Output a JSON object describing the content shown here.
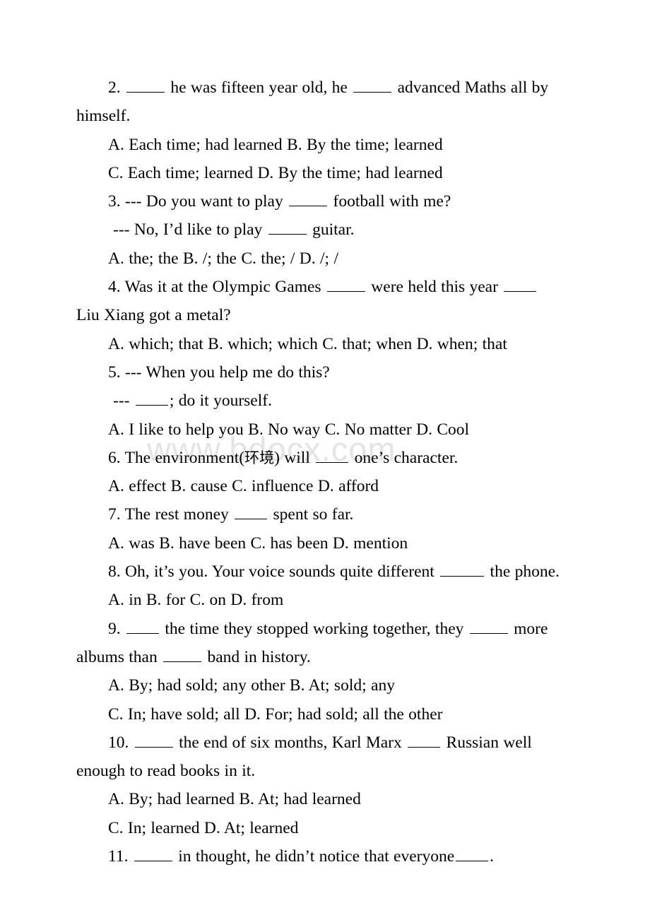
{
  "document": {
    "type": "exam-worksheet",
    "language": "English grammar multiple choice",
    "watermark": "www.bdocx.com",
    "watermark_color": "#e4e4e4",
    "text_color": "#000000",
    "background_color": "#ffffff"
  },
  "questions": [
    {
      "number": "2.",
      "stem_parts": [
        "2. ",
        " he was fifteen year old, he ",
        " advanced Maths all by himself."
      ],
      "stem_blanks": [
        "b-md",
        "b-md"
      ],
      "options": [
        "A. Each time; had learned B. By the time; learned",
        "C. Each time; learned D. By the time; had learned"
      ]
    },
    {
      "number": "3.",
      "stem_parts": [
        "3. --- Do you want to play ",
        " football with me?"
      ],
      "stem_blanks": [
        "b-md"
      ],
      "dialogue": [
        "--- No, I’d like to play ",
        " guitar."
      ],
      "dialogue_blanks": [
        "b-md"
      ],
      "options": [
        "A. the; the B. /; the C. the; / D. /; /"
      ]
    },
    {
      "number": "4.",
      "stem_parts": [
        "4. Was it at the Olympic Games ",
        " were held this year ",
        " Liu Xiang got a metal?"
      ],
      "stem_blanks": [
        "b-md",
        "b-sm"
      ],
      "options": [
        "A. which; that B. which; which C. that; when D. when; that"
      ]
    },
    {
      "number": "5.",
      "stem_parts": [
        "5. --- When you help me do this?"
      ],
      "stem_blanks": [],
      "dialogue": [
        "--- ",
        "; do it yourself."
      ],
      "dialogue_blanks": [
        "b-sm"
      ],
      "options": [
        "A. I like to help you B. No way C. No matter D. Cool"
      ]
    },
    {
      "number": "6.",
      "stem_parts": [
        "6. The environment(",
        "环境",
        ") will ",
        " one’s character."
      ],
      "stem_blanks": [
        "b-sm"
      ],
      "options": [
        "A. effect B. cause C. influence D. afford"
      ]
    },
    {
      "number": "7.",
      "stem_parts": [
        "7. The rest money ",
        " spent so far."
      ],
      "stem_blanks": [
        "b-sm"
      ],
      "options": [
        "A. was B. have been C. has been D. mention"
      ]
    },
    {
      "number": "8.",
      "stem_parts": [
        "8. Oh, it’s you. Your voice sounds quite different ",
        " the phone."
      ],
      "stem_blanks": [
        "b-lg"
      ],
      "options": [
        "A. in B. for C. on D. from"
      ]
    },
    {
      "number": "9.",
      "stem_parts": [
        "9. ",
        " the time they stopped working together, they ",
        " more albums than ",
        " band in history."
      ],
      "stem_blanks": [
        "b-sm",
        "b-md",
        "b-md"
      ],
      "options": [
        "A. By; had sold; any other B. At; sold; any",
        "C. In; have sold; all D. For; had sold; all the other"
      ]
    },
    {
      "number": "10.",
      "stem_parts": [
        "10. ",
        " the end of six months, Karl Marx ",
        " Russian well enough to read books in it."
      ],
      "stem_blanks": [
        "b-md",
        "b-sm"
      ],
      "options": [
        "A. By; had learned B. At; had learned",
        "C. In; learned D. At; learned"
      ]
    },
    {
      "number": "11.",
      "stem_parts": [
        "11. ",
        " in thought, he didn’t notice that everyone",
        "."
      ],
      "stem_blanks": [
        "b-md",
        "b-sm"
      ],
      "options": []
    }
  ]
}
